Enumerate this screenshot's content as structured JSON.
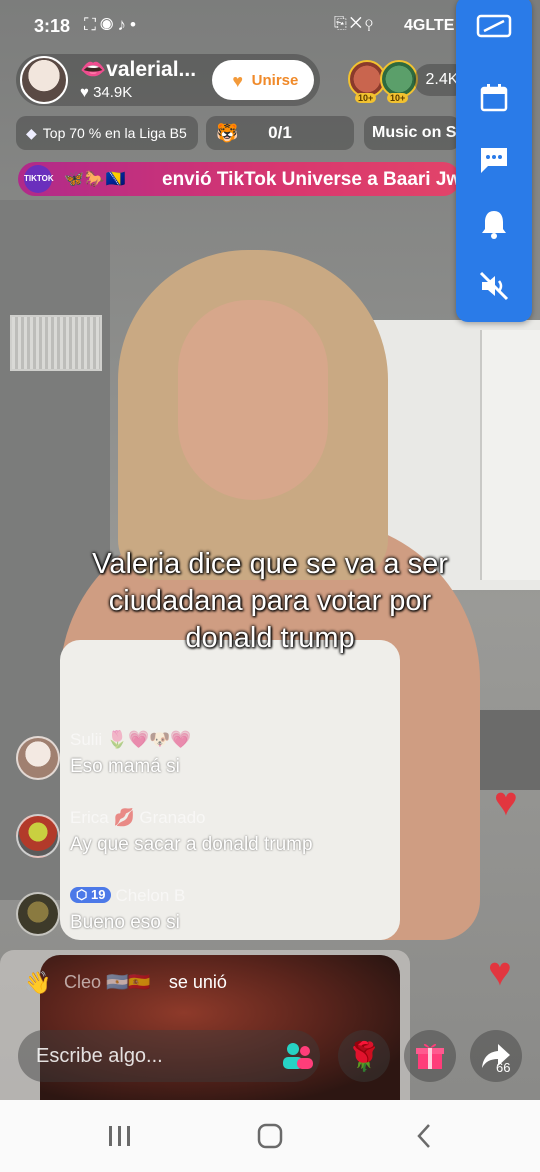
{
  "status_bar": {
    "time": "3:18",
    "left_icons": "⛶◉♪•",
    "right_icons": "⎘✕⚲",
    "network": "4GLTE"
  },
  "host": {
    "name": "valerial...",
    "likes": "34.9K",
    "join_label": "Unirse"
  },
  "viewers": {
    "level_1": "10+",
    "level_2": "10+",
    "count": "2.4K"
  },
  "pills": {
    "league": "Top 70 % en la Liga B5",
    "goal": "0/1",
    "music": "Music on S"
  },
  "gift_banner": {
    "badge": "TIKTOK LIVE",
    "emojis": "🦋🐎🇧🇦",
    "text": "envió TikTok Universe a Baari Jw"
  },
  "caption": {
    "line1": "Valeria dice que se va a ser",
    "line2": "ciudadana para votar por",
    "line3": "donald trump"
  },
  "comments": [
    {
      "user": "Sulii 🌷💗🐶💗",
      "level": "",
      "message": "Eso mamá si"
    },
    {
      "user": "Erica 💋 Granado",
      "level": "",
      "message": "Ay que sacar a donald trump"
    },
    {
      "user": "Chelon B",
      "level": "19",
      "message": "Bueno eso si"
    }
  ],
  "joined": {
    "name": "Cleo 🇦🇷🇪🇸",
    "text": "se unió"
  },
  "bottom": {
    "input_placeholder": "Escribe algo...",
    "share_count": "66"
  },
  "colors": {
    "side_panel": "#2a7be8",
    "banner": "#d8376f",
    "heart": "#e2363f",
    "join_text": "#f08a2a"
  }
}
